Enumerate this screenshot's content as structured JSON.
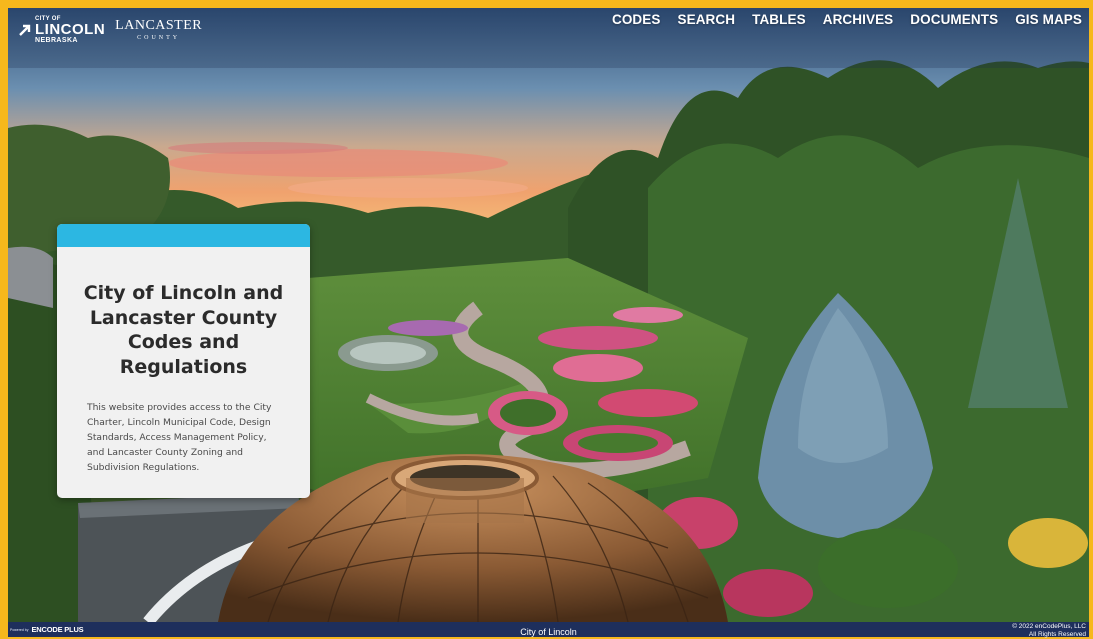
{
  "header": {
    "lincoln_logo": {
      "top": "CITY OF",
      "main": "LINCOLN",
      "bottom": "NEBRASKA"
    },
    "lancaster_logo": {
      "main": "LANCASTER",
      "bottom": "COUNTY"
    },
    "nav": [
      {
        "label": "CODES"
      },
      {
        "label": "SEARCH"
      },
      {
        "label": "TABLES"
      },
      {
        "label": "ARCHIVES"
      },
      {
        "label": "DOCUMENTS"
      },
      {
        "label": "GIS MAPS"
      }
    ]
  },
  "card": {
    "title": "City of Lincoln and Lancaster County Codes and Regulations",
    "body": "This website provides access to the City Charter, Lincoln Municipal Code, Design Standards, Access Management Policy, and Lancaster County Zoning and Subdivision Regulations.",
    "accent_color": "#2cb7e2"
  },
  "footer": {
    "powered_by": "Powered by",
    "brand": "ENCODE PLUS",
    "center": "City of Lincoln",
    "copyright": "© 2022 enCodePlus, LLC",
    "rights": "All Rights Reserved",
    "color": "#1e2f5c"
  },
  "colors": {
    "frame": "#f6b81c",
    "nav_text": "#ffffff"
  }
}
